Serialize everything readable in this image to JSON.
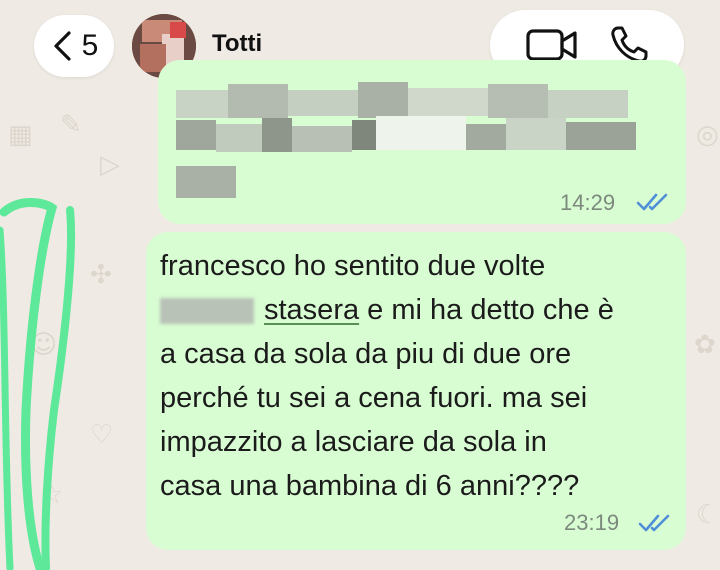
{
  "header": {
    "back_count": "5",
    "contact_name": "Totti",
    "icons": [
      "chevron-left-icon",
      "video-call-icon",
      "phone-icon"
    ]
  },
  "messages": [
    {
      "type": "outgoing",
      "content": "redacted",
      "time": "14:29",
      "status": "read"
    },
    {
      "type": "outgoing",
      "lines": [
        "francesco ho sentito due volte",
        "stasera e mi ha detto che è",
        "a casa da sola da piu di due ore",
        "perché tu sei a cena fuori. ma sei",
        "impazzito a lasciare da sola in",
        "casa una bambina di 6 anni????"
      ],
      "underlined_word": "stasera",
      "time": "23:19",
      "status": "read"
    }
  ],
  "colors": {
    "bubble": "#d9fdd3",
    "read_ticks": "#4f8fd8",
    "marker": "#5de89a",
    "wallpaper": "#efeae3"
  }
}
